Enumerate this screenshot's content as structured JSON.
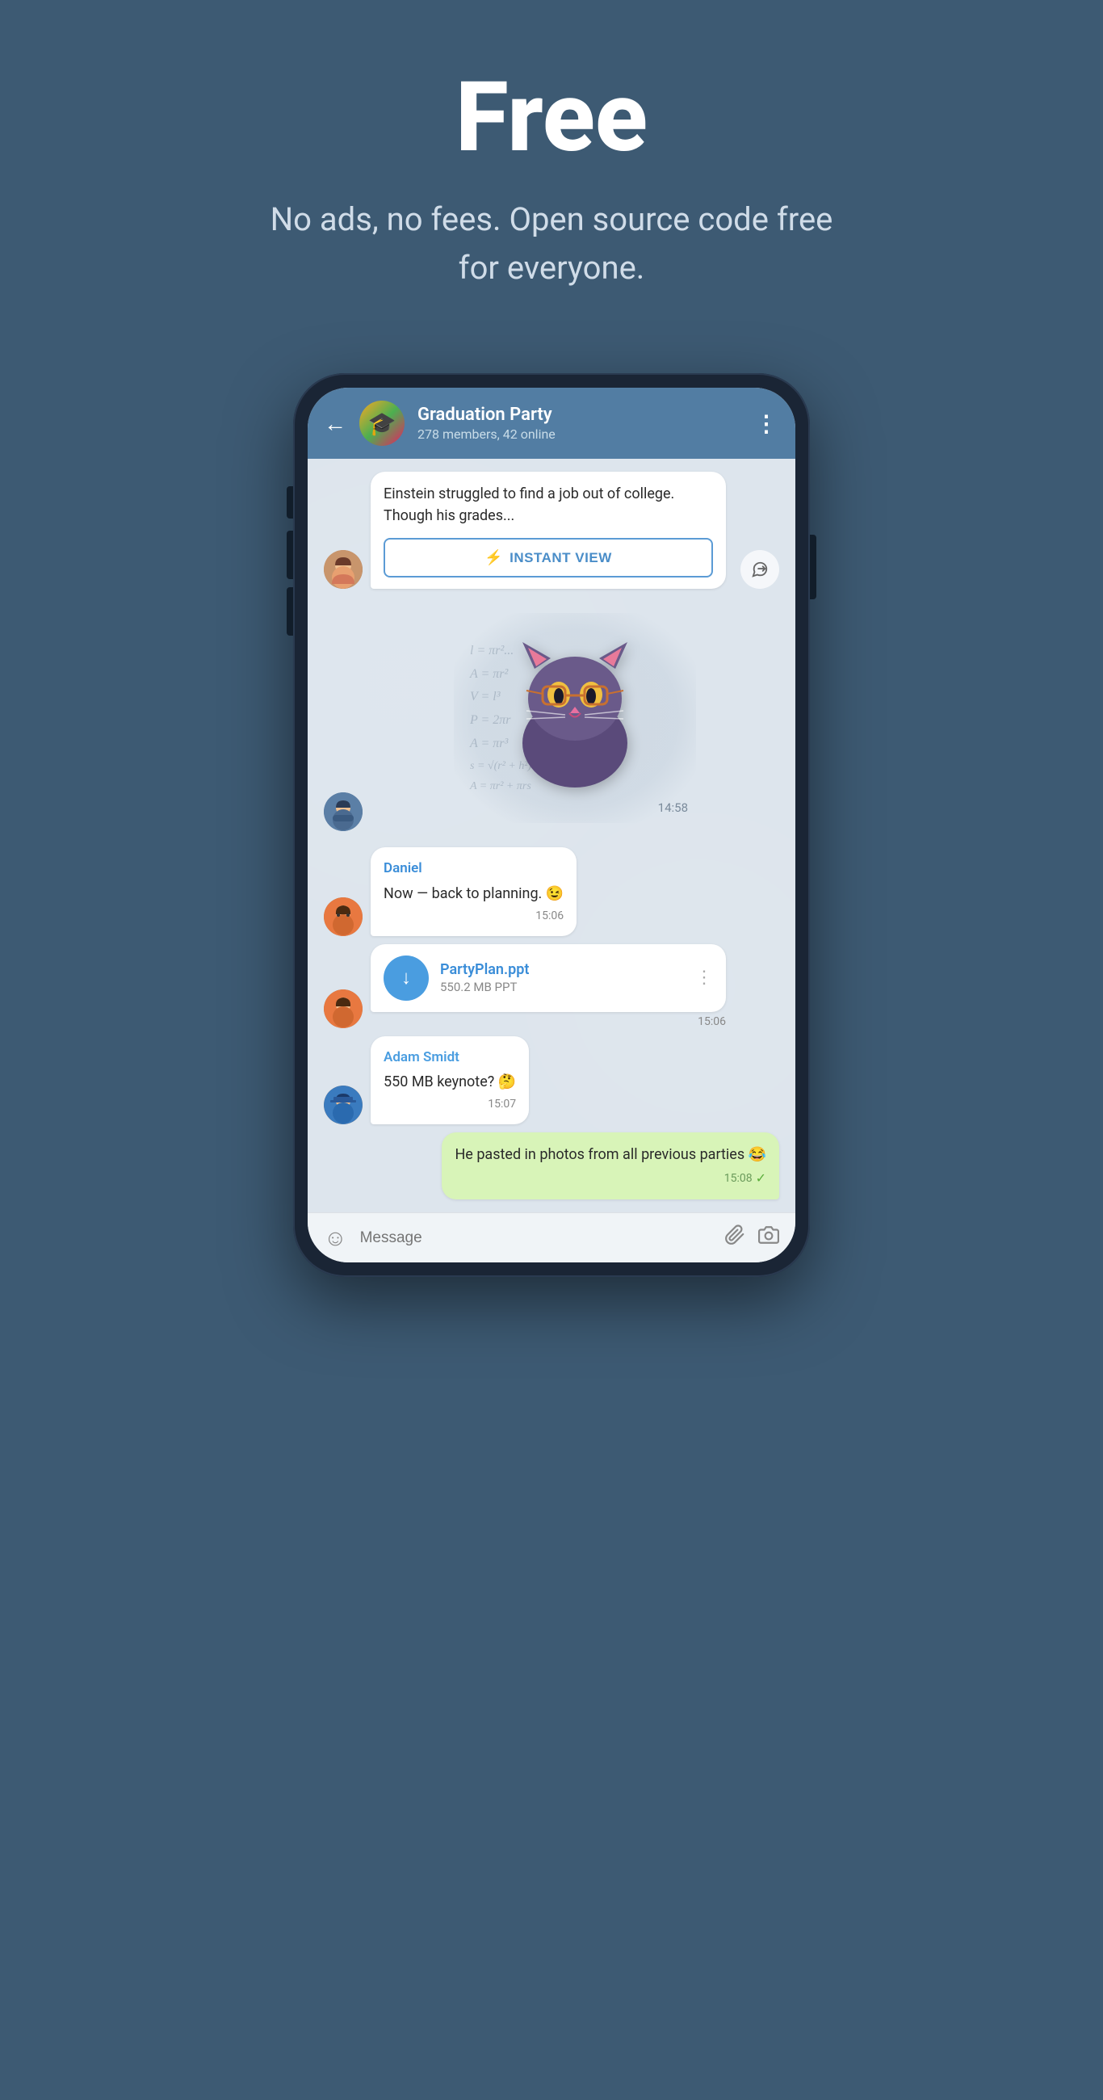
{
  "hero": {
    "title": "Free",
    "subtitle": "No ads, no fees. Open source code free for everyone."
  },
  "phone": {
    "header": {
      "back_label": "←",
      "group_name": "Graduation Party",
      "group_meta": "278 members, 42 online",
      "menu_label": "⋮"
    },
    "messages": [
      {
        "id": "article-msg",
        "type": "article",
        "avatar": "woman",
        "article_text": "Einstein struggled to find a job out of college. Though his grades...",
        "instant_view_label": "INSTANT VIEW",
        "bolt": "⚡"
      },
      {
        "id": "sticker-msg",
        "type": "sticker",
        "avatar": "man1",
        "time": "14:58"
      },
      {
        "id": "daniel-msg",
        "type": "text",
        "avatar": "man2",
        "sender": "Daniel",
        "text": "Now — back to planning. 😉",
        "time": "15:06"
      },
      {
        "id": "file-msg",
        "type": "file",
        "avatar": "man2",
        "file_name": "PartyPlan.ppt",
        "file_size": "550.2 MB PPT",
        "time": "15:06"
      },
      {
        "id": "adam-msg",
        "type": "text",
        "avatar": "man3",
        "sender": "Adam Smidt",
        "text": "550 MB keynote? 🤔",
        "time": "15:07"
      },
      {
        "id": "own-msg",
        "type": "own",
        "text": "He pasted in photos from all previous parties 😂",
        "time": "15:08",
        "checkmark": "✓"
      }
    ],
    "input": {
      "placeholder": "Message",
      "emoji_icon": "☺",
      "attach_icon": "📎",
      "camera_icon": "⊙"
    }
  }
}
